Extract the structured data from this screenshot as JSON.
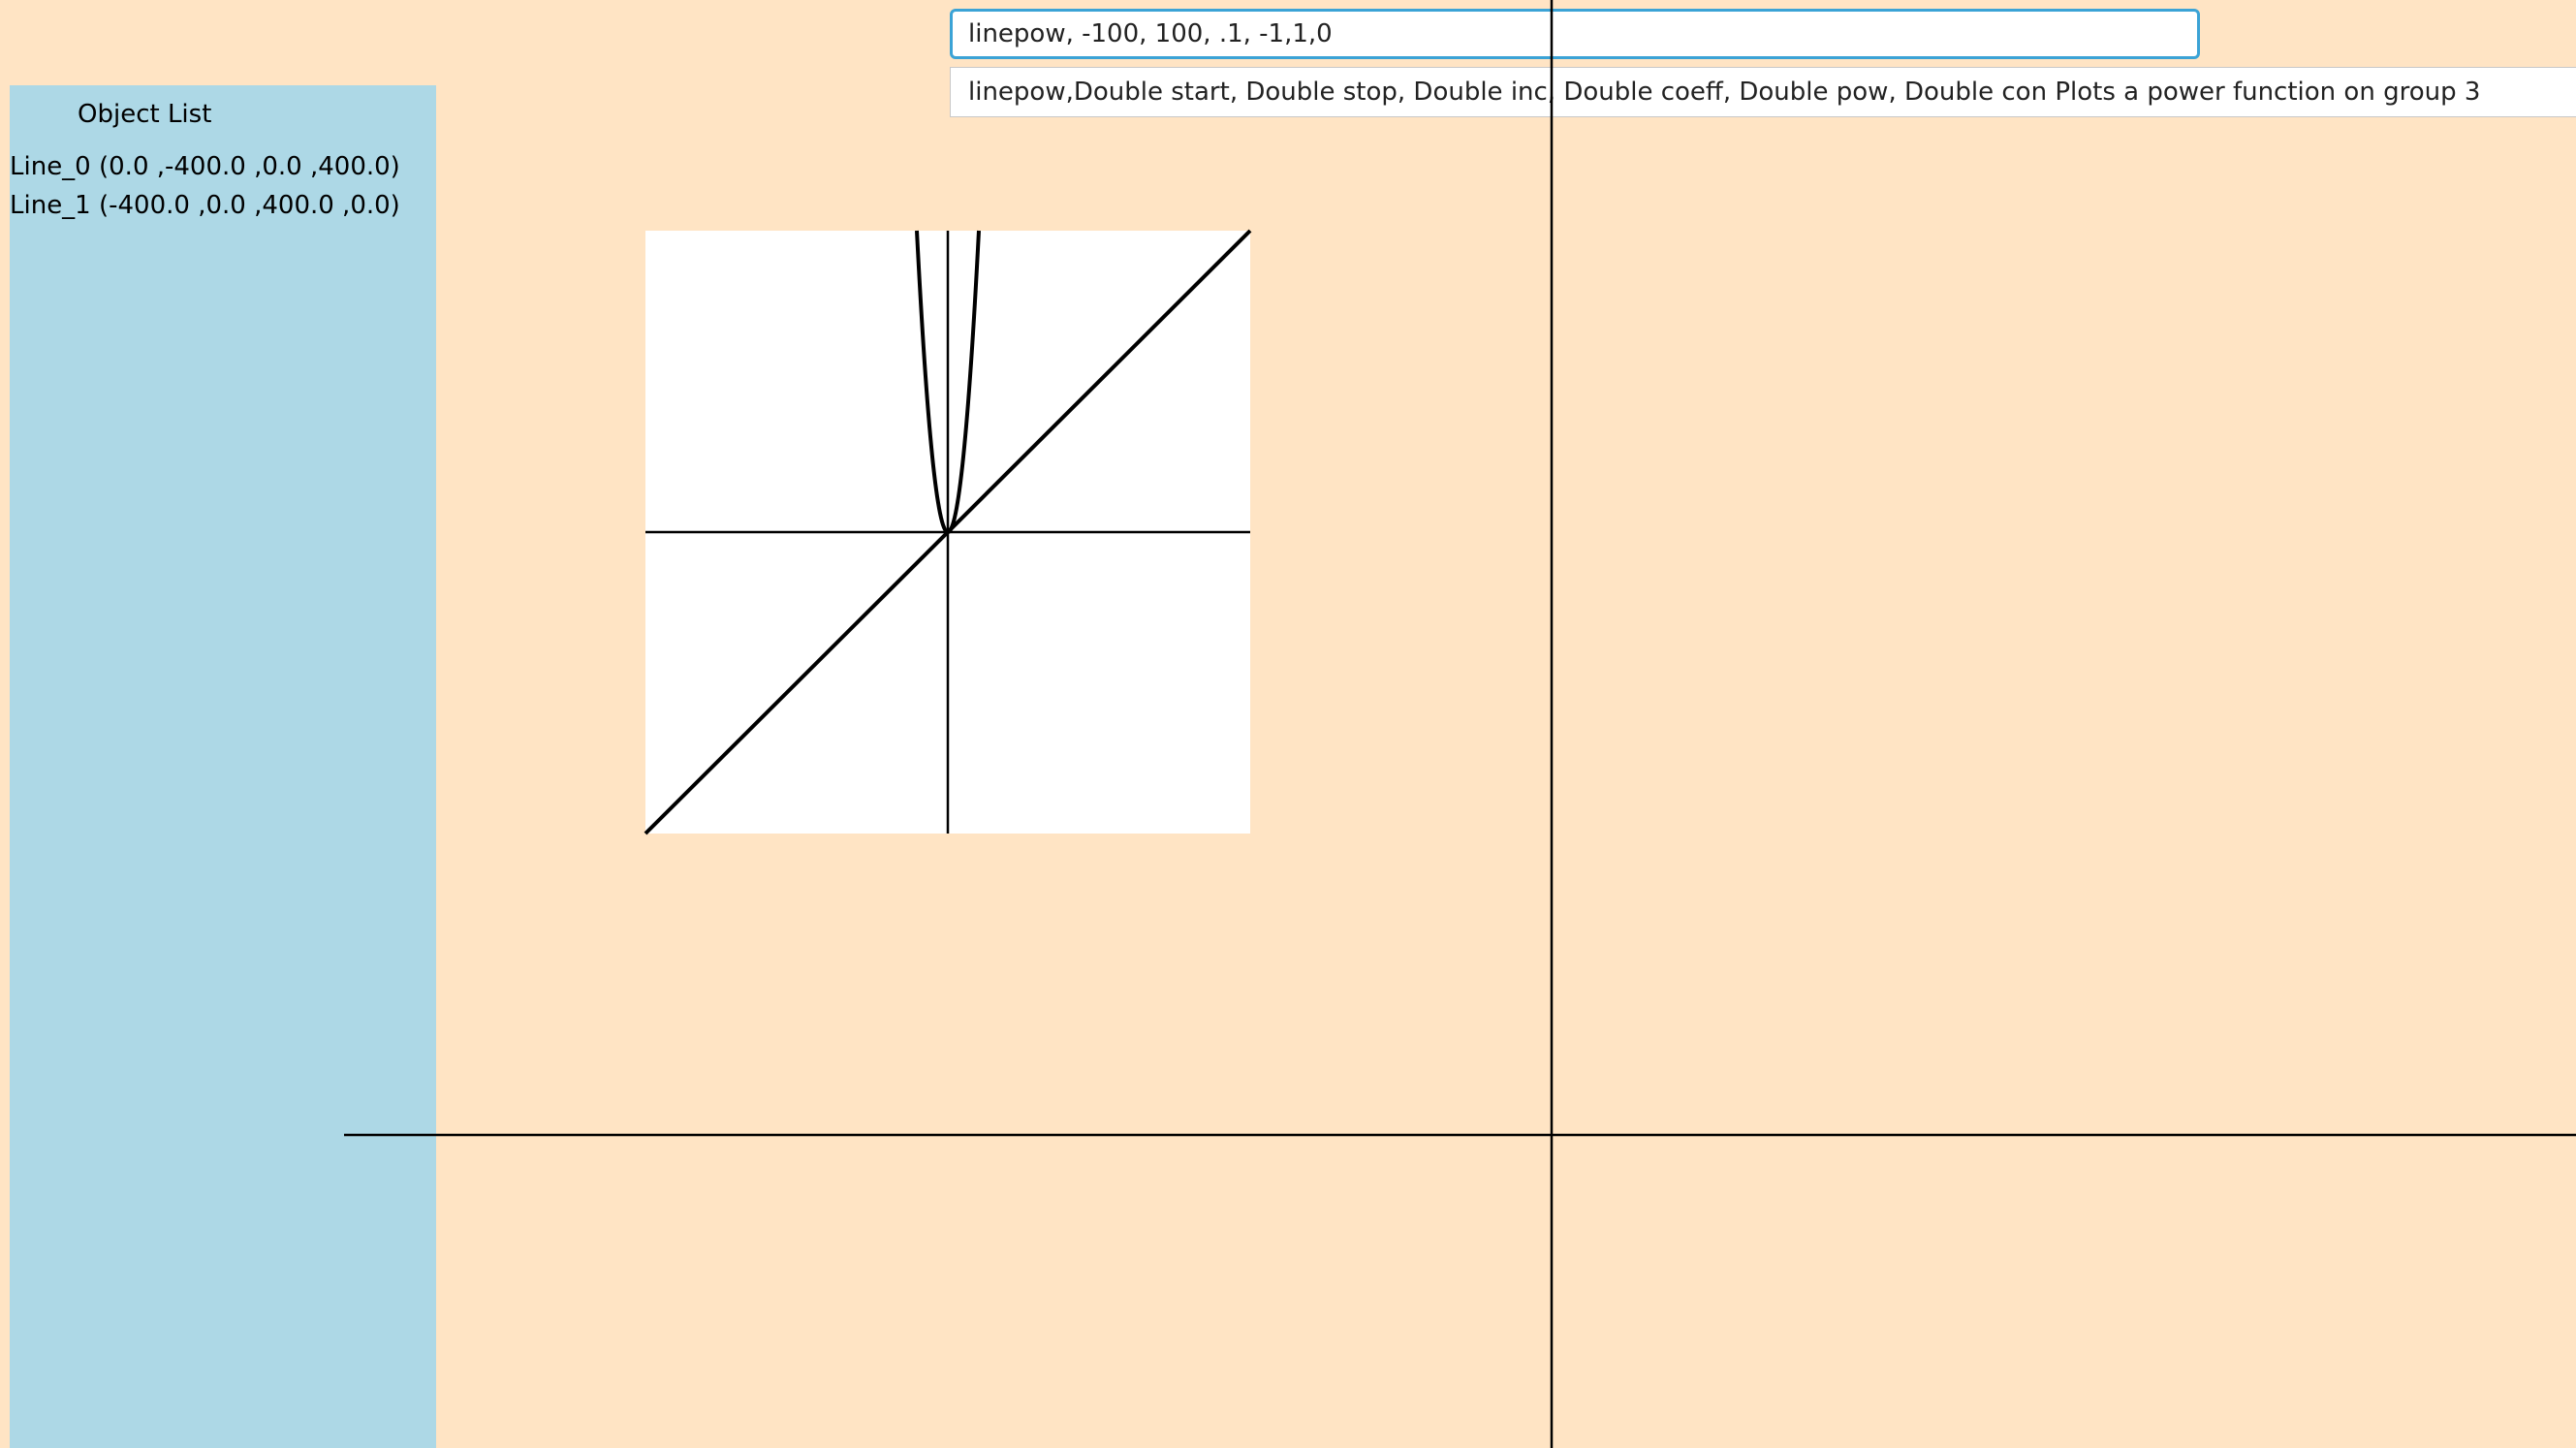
{
  "object_list": {
    "title": "Object List",
    "items": [
      {
        "label": "Line_0 (0.0 ,-400.0 ,0.0 ,400.0)"
      },
      {
        "label": "Line_1 (-400.0 ,0.0 ,400.0 ,0.0)"
      }
    ]
  },
  "command": {
    "value": "linepow, -100, 100, .1, -1,1,0"
  },
  "help": {
    "text": "linepow,Double start, Double stop, Double inc, Double coeff, Double pow, Double con Plots a power function on group 3"
  },
  "colors": {
    "background": "#FFE4C4",
    "sidebar": "#ADD8E6",
    "input_focus_border": "#3BA3D6",
    "axis": "#000000",
    "plot_background": "#FFFFFF"
  }
}
